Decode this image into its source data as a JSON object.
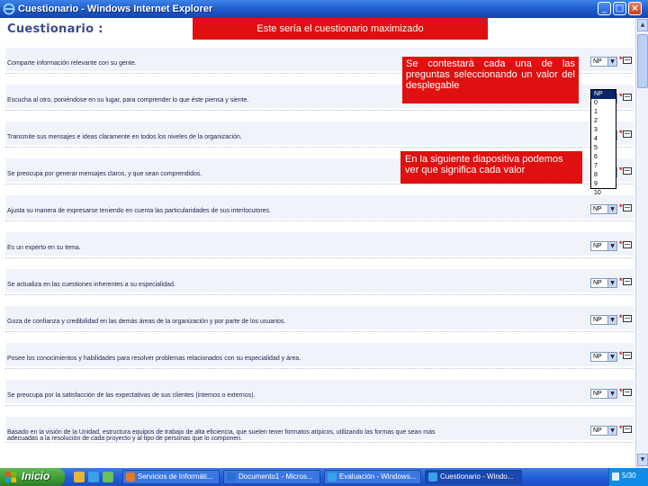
{
  "window": {
    "title": "Cuestionario - Windows Internet Explorer"
  },
  "page": {
    "title": "Cuestionario :"
  },
  "callouts": {
    "top": "Este sería el cuestionario maximizado",
    "dropdown": "Se contestará cada una de las preguntas seleccionando un valor del desplegable",
    "next": "En la siguiente diapositiva podemos ver que significa cada valor"
  },
  "questions": [
    {
      "text": "Comparte información relevante con su gente.",
      "value": "NP"
    },
    {
      "text": "Escucha al otro, poniéndose en su lugar, para comprender lo que éste piensa y siente.",
      "value": "NP"
    },
    {
      "text": "Transmite sus mensajes e ideas claramente en todos los niveles de la organización.",
      "value": "NP"
    },
    {
      "text": "Se preocupa por generar mensajes claros, y que sean comprendidos.",
      "value": "NP"
    },
    {
      "text": "Ajusta su manera de expresarse teniendo en cuenta las particularidades de sus interlocutores.",
      "value": "NP"
    },
    {
      "text": "Es un experto en su tema.",
      "value": "NP"
    },
    {
      "text": "Se actualiza en las cuestiones inherentes a su especialidad.",
      "value": "NP"
    },
    {
      "text": "Goza de confianza y credibilidad en las demás áreas de la organización y por parte de los usuarios.",
      "value": "NP"
    },
    {
      "text": "Posee los conocimientos y habilidades para resolver problemas relacionados con su especialidad y área.",
      "value": "NP"
    },
    {
      "text": "Se preocupa por la satisfacción de las expectativas de sus clientes (internos o externos).",
      "value": "NP"
    },
    {
      "text": "Basado en la visión de la Unidad, estructura equipos de trabajo de alta eficiencia, que suelen tener formatos atípicos, utilizando las formas que sean más",
      "text2": "adecuadas a la resolución de cada proyecto y al tipo de personas que lo componen.",
      "value": "NP"
    }
  ],
  "dropdown": {
    "open_on_question": 1,
    "options": [
      "NP",
      "0",
      "1",
      "2",
      "3",
      "4",
      "5",
      "6",
      "7",
      "8",
      "9",
      "10"
    ],
    "selected": "NP"
  },
  "taskbar": {
    "start_label": "Inicio",
    "tasks": [
      {
        "label": "Servicios de Informáti...",
        "active": false
      },
      {
        "label": "Documento1 - Micros...",
        "active": false
      },
      {
        "label": "Evaluación - Windows...",
        "active": false
      },
      {
        "label": "Cuestionario - Windo...",
        "active": true
      }
    ],
    "slide_number": "5/30"
  },
  "colors": {
    "callout": "#e01010",
    "titlebar": "#245edb",
    "row_band": "#f1f3fb",
    "start": "#3c9a34"
  }
}
